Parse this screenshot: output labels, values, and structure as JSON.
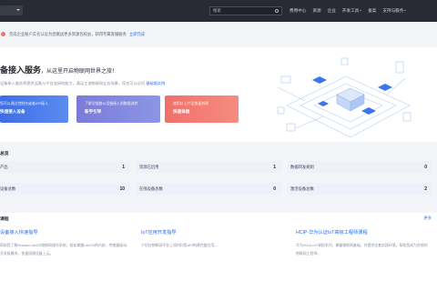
{
  "topbar": {
    "region": "",
    "search_placeholder": "搜索",
    "links": [
      "费用中心",
      "资源",
      "企业",
      "开发工具",
      "备案",
      "支持与服务"
    ]
  },
  "notice": {
    "text": "完成企业账户实名认证为您赠送更多资源包权益，获得专属客服服务",
    "link": "立即完成"
  },
  "hero": {
    "title": "备接入服务",
    "subtitle": "，从这里开启物联网世界之旅！",
    "desc": "设备接入服务将提供设备与平台连接的能力，满足主流物联网业务场景。您也可以访问",
    "desc_link": "基础版实例",
    "cards": [
      {
        "line1": "您可以通过控制台或者API接入",
        "line2": "快速接入设备"
      },
      {
        "line1": "了解全链路从设备接入到数据流转",
        "line2": "新手引导"
      },
      {
        "line1": "使用以上产品快速创建",
        "line2": "快速体验"
      }
    ]
  },
  "stats": {
    "title": "总览",
    "items": [
      {
        "label": "产品",
        "value": "1"
      },
      {
        "label": "资源已启用",
        "value": "1"
      },
      {
        "label": "数据转发规则",
        "value": "0"
      },
      {
        "label": "设备总数",
        "value": "10"
      },
      {
        "label": "在线设备总数",
        "value": "0"
      },
      {
        "label": "激活设备总数",
        "value": "2"
      }
    ]
  },
  "courses": {
    "title": "课程",
    "more": "更多",
    "items": [
      {
        "title": "设备接入快速指导",
        "desc": "帮助您了解Huawei LiteOS物联网操作系统，轻松掌握LiteOS的内核、传感器驱动、开发板模块，快速搭建设备上云。"
      },
      {
        "title": "IoT应用开发指导",
        "desc": "介绍在物联网平台上如何利用API构建完整应用。"
      },
      {
        "title": "HCIP-华为认证IoT高级工程师课程",
        "desc": "华为HCIA-IoT课程系列，掌握物联网基础，并提供全套实践环境，帮助您成为合格的物联网工程师。"
      }
    ]
  }
}
